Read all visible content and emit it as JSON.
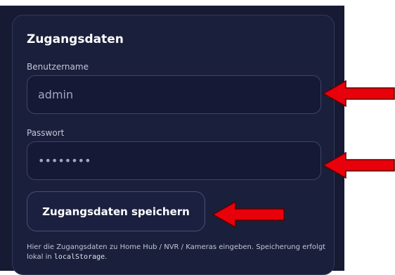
{
  "card": {
    "title": "Zugangsdaten"
  },
  "username": {
    "label": "Benutzername",
    "value": "admin"
  },
  "password": {
    "label": "Passwort",
    "value": "secret12"
  },
  "save_button": {
    "label": "Zugangsdaten speichern"
  },
  "hint": {
    "text_before": "Hier die Zugangsdaten zu Home Hub / NVR / Kameras eingeben. Speicherung erfolgt lokal in ",
    "code": "localStorage",
    "text_after": "."
  },
  "annotations": {
    "arrow_color": "#e8000b",
    "arrow_outline": "#5a0000"
  }
}
